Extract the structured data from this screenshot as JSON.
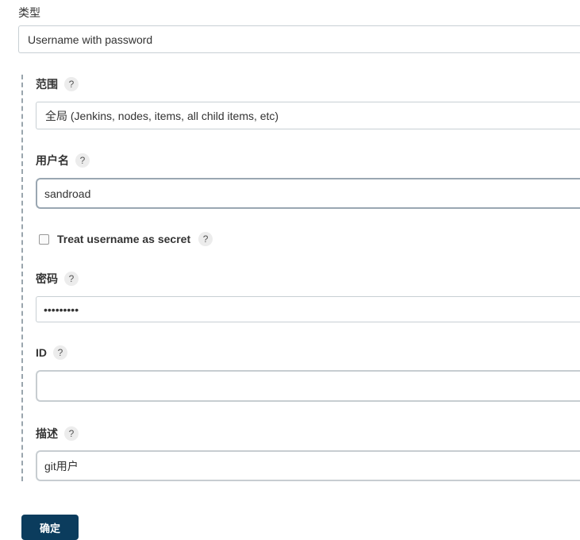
{
  "kind": {
    "label": "类型",
    "selected": "Username with password"
  },
  "scope": {
    "label": "范围",
    "help": "?",
    "selected": "全局 (Jenkins, nodes, items, all child items, etc)"
  },
  "username": {
    "label": "用户名",
    "help": "?",
    "value": "sandroad"
  },
  "username_secret": {
    "label": "Treat username as secret",
    "help": "?",
    "checked": false
  },
  "password": {
    "label": "密码",
    "help": "?",
    "masked_value": "•••••••••"
  },
  "id": {
    "label": "ID",
    "help": "?",
    "value": ""
  },
  "description": {
    "label": "描述",
    "help": "?",
    "value": "git用户"
  },
  "actions": {
    "confirm_label": "确定"
  },
  "colors": {
    "primary_button": "#0b3c5d",
    "help_bg": "#ececec"
  }
}
